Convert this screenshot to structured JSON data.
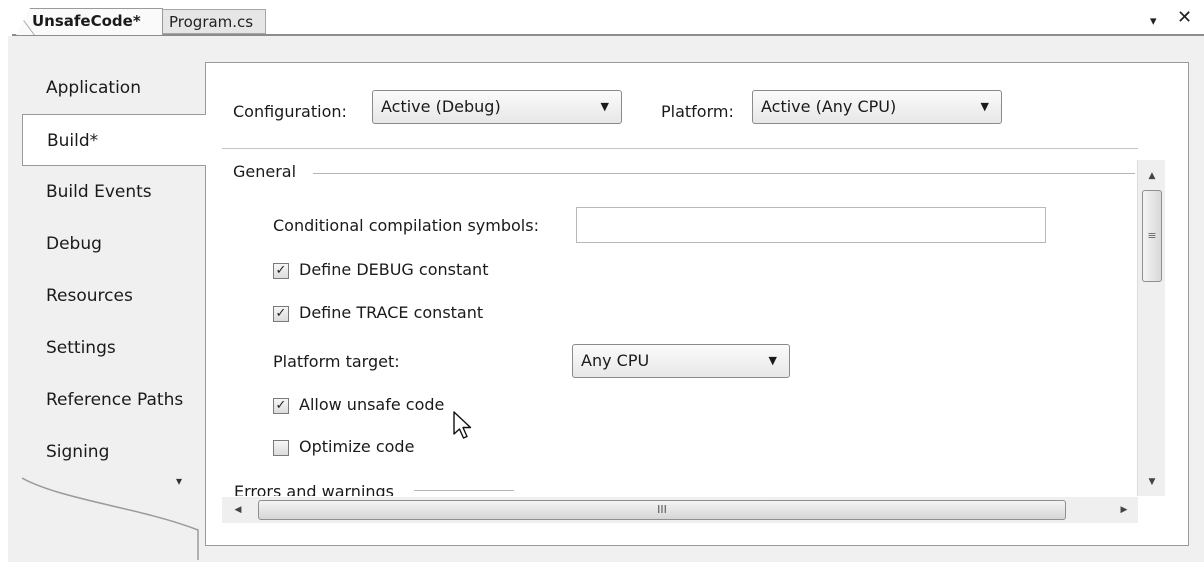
{
  "document_tabs": [
    {
      "label": "UnsafeCode*",
      "active": true
    },
    {
      "label": "Program.cs",
      "active": false
    }
  ],
  "window_controls": {
    "dropdown_icon": "▾",
    "close_icon": "✕"
  },
  "side_tabs": [
    {
      "label": "Application"
    },
    {
      "label": "Build*",
      "selected": true
    },
    {
      "label": "Build Events"
    },
    {
      "label": "Debug"
    },
    {
      "label": "Resources"
    },
    {
      "label": "Settings"
    },
    {
      "label": "Reference Paths"
    },
    {
      "label": "Signing"
    }
  ],
  "side_more_icon": "▾",
  "toolbar": {
    "configuration_label": "Configuration:",
    "configuration_value": "Active (Debug)",
    "platform_label": "Platform:",
    "platform_value": "Active (Any CPU)"
  },
  "general": {
    "section_title": "General",
    "conditional_symbols_label": "Conditional compilation symbols:",
    "conditional_symbols_value": "",
    "define_debug_label": "Define DEBUG constant",
    "define_debug_checked": true,
    "define_trace_label": "Define TRACE constant",
    "define_trace_checked": true,
    "platform_target_label": "Platform target:",
    "platform_target_value": "Any CPU",
    "allow_unsafe_label": "Allow unsafe code",
    "allow_unsafe_checked": true,
    "optimize_label": "Optimize code",
    "optimize_checked": false
  },
  "next_section_title": "Errors and warnings",
  "check_glyph": "✓",
  "dropdown_glyph": "▼",
  "scroll": {
    "up": "▲",
    "down": "▼",
    "left": "◀",
    "right": "▶",
    "v_grip": "≡",
    "h_grip": "III"
  }
}
